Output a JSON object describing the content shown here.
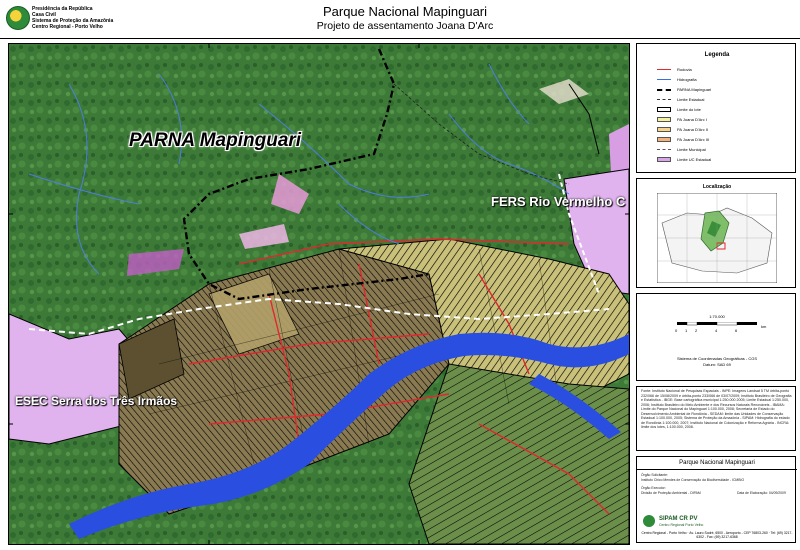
{
  "header": {
    "org_lines": [
      "Presidência da República",
      "Casa Civil",
      "Sistema de Proteção da Amazônia",
      "Centro Regional - Porto Velho"
    ],
    "title": "Parque Nacional Mapinguari",
    "subtitle": "Projeto de assentamento Joana D'Arc"
  },
  "map": {
    "labels": {
      "parna": "PARNA Mapinguari",
      "fers": "FERS Rio Vermelho C",
      "esec": "ESEC Serra dos Três Irmãos"
    }
  },
  "legend": {
    "title": "Legenda",
    "items": [
      {
        "label": "Rodovia",
        "symbol": "line",
        "color": "#e0282e"
      },
      {
        "label": "Hidrografia",
        "symbol": "line",
        "color": "#3b6fe0"
      },
      {
        "label": "PARNA Mapinguari",
        "symbol": "dash",
        "color": "#000000"
      },
      {
        "label": "Limite Estadual",
        "symbol": "dashthin",
        "color": "#333333"
      },
      {
        "label": "Limite do lote",
        "symbol": "box",
        "color": "#000000"
      },
      {
        "label": "PA Joana D'Arc I",
        "symbol": "fill",
        "color": "#f5f3a0"
      },
      {
        "label": "PA Joana D'Arc II",
        "symbol": "fill",
        "color": "#f7d58a"
      },
      {
        "label": "PA Joana D'Arc III",
        "symbol": "fill",
        "color": "#f3b37a"
      },
      {
        "label": "Limite Municipal",
        "symbol": "dashthin",
        "color": "#555555"
      },
      {
        "label": "Limite UC Estadual",
        "symbol": "fill",
        "color": "#d9a7e8"
      }
    ]
  },
  "location": {
    "title": "Localização"
  },
  "scale": {
    "ratio": "1:70.000",
    "ticks": [
      "0",
      "1",
      "2",
      "4",
      "6"
    ],
    "unit": "km",
    "system": "Sistema de Coordenadas Geográficas - CGS",
    "datum": "Datum: SAD 69"
  },
  "notes": {
    "text": "Fonte: Instituto Nacional de Pesquisas Espaciais - INPE: Imagens Landsat 5 TM órbita-ponto 232/066 de 15/08/2009 e órbita-ponto 233/066 de 03/07/2009; Instituto Brasileiro de Geografia e Estatística - IBGE: Base cartográfica municipal 1:250.000 2005; Limite Estadual 1:250.000, 2006; Instituto Brasileiro do Meio Ambiente e dos Recursos Naturais Renováveis - IBAMA: Limite do Parque Nacional do Mapinguari 1:100.000, 2008; Secretaria de Estado do Desenvolvimento Ambiental de Rondônia - SEDAM: limite das Unidades de Conservação Estadual 1:100.000, 2005; Sistema de Proteção da Amazônia - SIPAM: Hidrografia do estado de Rondônia 1:100.000, 2007; Instituto Nacional de Colonização e Reforma Agrária - INCRA: limite dos lotes, 1:100.000, 2008."
  },
  "info": {
    "title": "Parque Nacional Mapinguari",
    "rows": [
      "Órgão Solicitante:",
      "Instituto Chico Mendes de Conservação da Biodiversidade - ICMBIO",
      "Órgão Executor:",
      "Divisão de Proteção Ambiental - DIPAM",
      "Data de Elaboração: 04/09/2009"
    ],
    "agency": "SIPAM CR PV",
    "agency_sub": "Centro Regional Porto Velho",
    "footer": "Centro Regional - Porto Velho · Av. Lauro Sodré, 6500 - Aeroporto - CEP 76803-260 · Tel: (69) 3217-6302 - Fax: (69) 3217-6368"
  },
  "colors": {
    "forest": "#3f7a3a",
    "river": "#2a4fe0",
    "road": "#e0282e",
    "protected_area": "#e8b8f2",
    "settlement_lines": "#000000"
  }
}
